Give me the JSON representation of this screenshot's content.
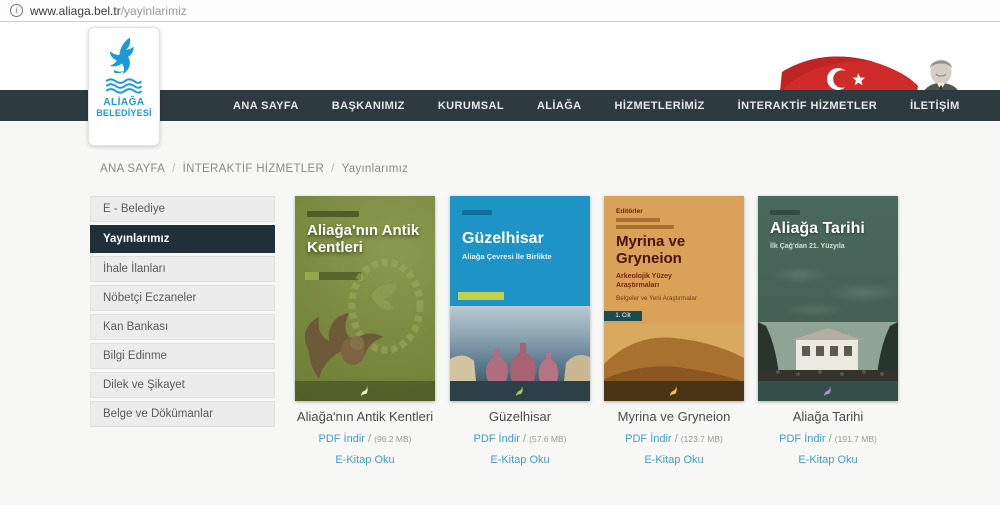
{
  "browser": {
    "url_domain": "www.aliaga.bel.tr",
    "url_path": "/yayinlarimiz",
    "info_glyph": "i"
  },
  "logo": {
    "line1": "ALİAĞA",
    "line2": "BELEDİYESİ",
    "accent": "#1b9ad6"
  },
  "nav": {
    "items": [
      "ANA SAYFA",
      "BAŞKANIMIZ",
      "KURUMSAL",
      "ALİAĞA",
      "HİZMETLERİMİZ",
      "İNTERAKTİF HİZMETLER",
      "İLETİŞİM"
    ]
  },
  "breadcrumb": {
    "part1": "ANA SAYFA",
    "sep1": "/",
    "part2": "İNTERAKTİF HİZMETLER",
    "sep2": "/",
    "part3": "Yayınlarımız"
  },
  "sidebar": {
    "items": [
      {
        "label": "E - Belediye"
      },
      {
        "label": "Yayınlarımız"
      },
      {
        "label": "İhale İlanları"
      },
      {
        "label": "Nöbetçi Eczaneler"
      },
      {
        "label": "Kan Bankası"
      },
      {
        "label": "Bilgi Edinme"
      },
      {
        "label": "Dilek ve Şikayet"
      },
      {
        "label": "Belge ve Dökümanlar"
      }
    ]
  },
  "books": [
    {
      "cover_title": "Aliağa'nın Antik Kentleri",
      "title": "Aliağa'nın Antik Kentleri",
      "pdf_label": "PDF İndir",
      "sep": "/",
      "size": "(96.2 MB)",
      "ebook_label": "E-Kitap Oku"
    },
    {
      "cover_title": "Güzelhisar",
      "cover_subtitle": "Aliağa Çevresi İle Birlikte",
      "title": "Güzelhisar",
      "pdf_label": "PDF İndir",
      "sep": "/",
      "size": "(57.6 MB)",
      "ebook_label": "E-Kitap Oku"
    },
    {
      "cover_eyebrow": "Editörler",
      "cover_title": "Myrina ve Gryneion",
      "cover_subtitle": "Arkeolojik Yüzey Araştırmaları",
      "cover_extra": "Belgeler ve Yeni Araştırmalar",
      "cover_badge": "1. Cilt",
      "title": "Myrina ve Gryneion",
      "pdf_label": "PDF İndir",
      "sep": "/",
      "size": "(123.7 MB)",
      "ebook_label": "E-Kitap Oku"
    },
    {
      "cover_title": "Aliağa Tarihi",
      "cover_subtitle": "İlk Çağ'dan 21. Yüzyıla",
      "title": "Aliağa Tarihi",
      "pdf_label": "PDF İndir",
      "sep": "/",
      "size": "(191.7 MB)",
      "ebook_label": "E-Kitap Oku"
    }
  ],
  "colors": {
    "navbar": "#2d3a40",
    "link_blue": "#3f9fc8",
    "logo_blue": "#1b9ad6",
    "active_sidebar": "#20303a"
  }
}
